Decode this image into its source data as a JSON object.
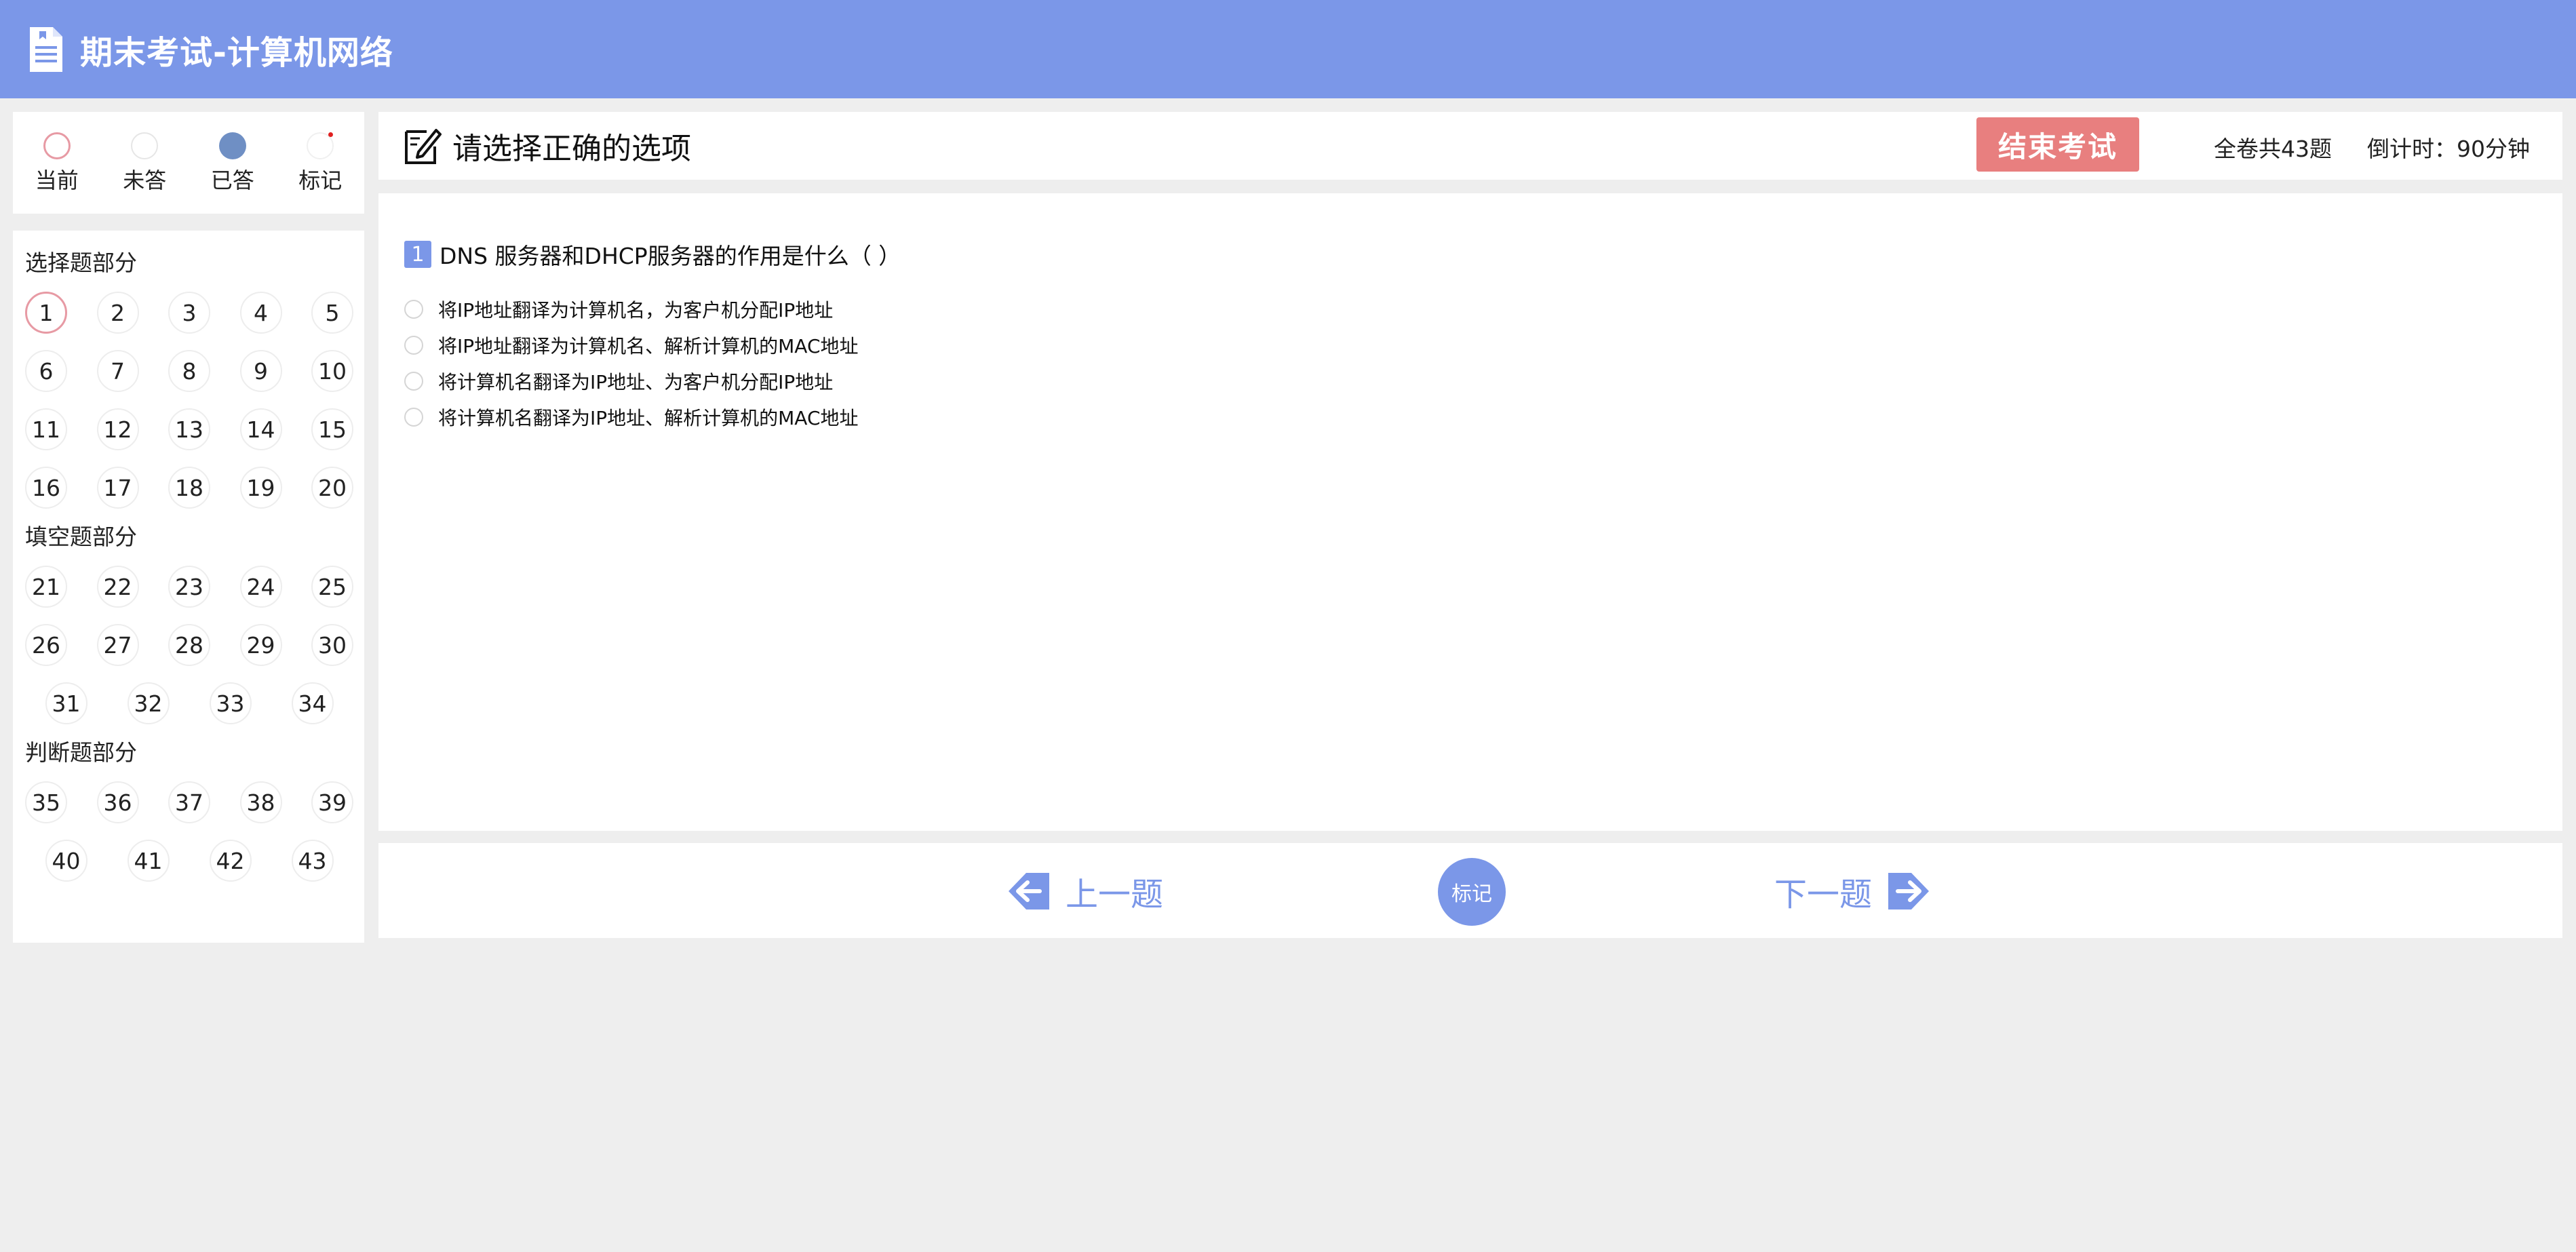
{
  "header": {
    "title": "期末考试-计算机网络",
    "icon": "document-icon",
    "background": "#7b97e8"
  },
  "legend": {
    "items": [
      {
        "label": "当前",
        "state": "current"
      },
      {
        "label": "未答",
        "state": "unanswered"
      },
      {
        "label": "已答",
        "state": "answered"
      },
      {
        "label": "标记",
        "state": "marked"
      }
    ]
  },
  "sections": [
    {
      "title": "选择题部分",
      "rows": [
        [
          1,
          2,
          3,
          4,
          5
        ],
        [
          6,
          7,
          8,
          9,
          10
        ],
        [
          11,
          12,
          13,
          14,
          15
        ],
        [
          16,
          17,
          18,
          19,
          20
        ]
      ]
    },
    {
      "title": "填空题部分",
      "rows": [
        [
          21,
          22,
          23,
          24,
          25
        ],
        [
          26,
          27,
          28,
          29,
          30
        ],
        [
          31,
          32,
          33,
          34
        ]
      ]
    },
    {
      "title": "判断题部分",
      "rows": [
        [
          35,
          36,
          37,
          38,
          39
        ],
        [
          40,
          41,
          42,
          43
        ]
      ]
    }
  ],
  "current_question": 1,
  "mainbar": {
    "instruction": "请选择正确的选项",
    "end_exam_label": "结束考试",
    "total_label": "全卷共43题",
    "timer_label": "倒计时：90分钟"
  },
  "question": {
    "number": "1",
    "text": "DNS 服务器和DHCP服务器的作用是什么（ ）",
    "options": [
      "将IP地址翻译为计算机名，为客户机分配IP地址",
      "将IP地址翻译为计算机名、解析计算机的MAC地址",
      "将计算机名翻译为IP地址、为客户机分配IP地址",
      "将计算机名翻译为IP地址、解析计算机的MAC地址"
    ]
  },
  "nav": {
    "prev_label": "上一题",
    "mark_label": "标记",
    "next_label": "下一题"
  },
  "colors": {
    "accent": "#7b97e8",
    "end_button": "#e87f7f",
    "current_ring": "#e79aa4",
    "answered": "#6f8fc4"
  }
}
